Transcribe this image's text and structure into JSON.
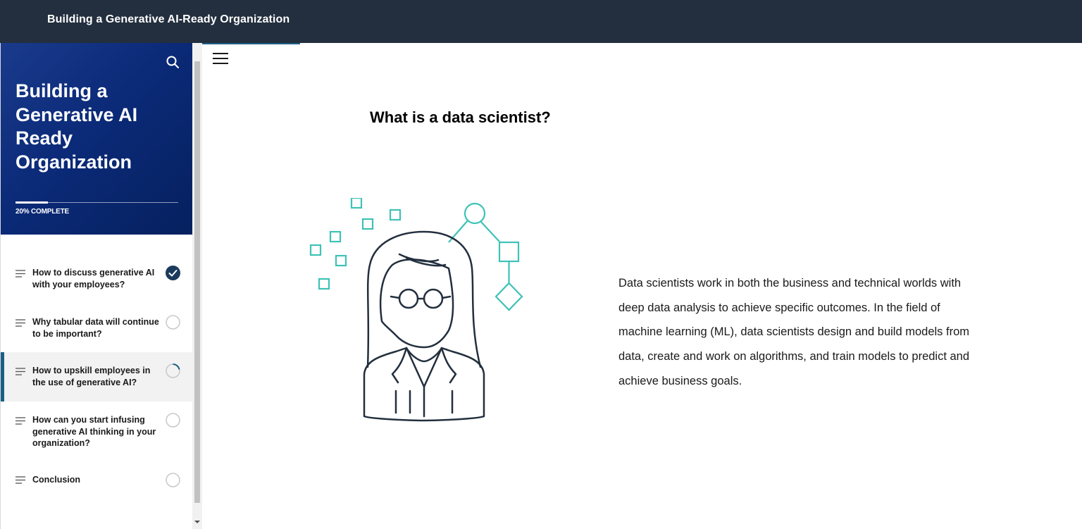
{
  "app": {
    "title": "Building a Generative AI-Ready Organization"
  },
  "sidebar": {
    "course_title": "Building a Generative AI Ready Organization",
    "progress": {
      "percent": 20,
      "label": "20% COMPLETE"
    },
    "lessons": [
      {
        "label": "How to discuss generative AI with your employees?",
        "status": "complete"
      },
      {
        "label": "Why tabular data will continue to be important?",
        "status": "not-started"
      },
      {
        "label": "How to upskill employees in the use of generative AI?",
        "status": "in-progress",
        "active": true
      },
      {
        "label": "How can you start infusing generative AI thinking in your organization?",
        "status": "not-started"
      },
      {
        "label": "Conclusion",
        "status": "not-started"
      }
    ]
  },
  "content": {
    "heading": "What is a data scientist?",
    "paragraph": "Data scientists work in both the business and technical worlds with deep data analysis to achieve specific outcomes. In the field of machine learning (ML), data scientists design and build models from data, create and work on algorithms, and train models to predict and achieve business goals.",
    "illustration": "data-scientist-illustration"
  },
  "colors": {
    "topbar": "#232f3e",
    "sidebar_header": "#0b2a78",
    "accent": "#1b5f85",
    "teal": "#3ec2b7",
    "outline": "#232f3e"
  },
  "icons": {
    "search": "search-icon",
    "menu": "hamburger-menu-icon",
    "lesson": "lines-icon",
    "complete": "check-circle-icon",
    "empty": "empty-circle-icon",
    "in_progress": "progress-circle-icon"
  }
}
